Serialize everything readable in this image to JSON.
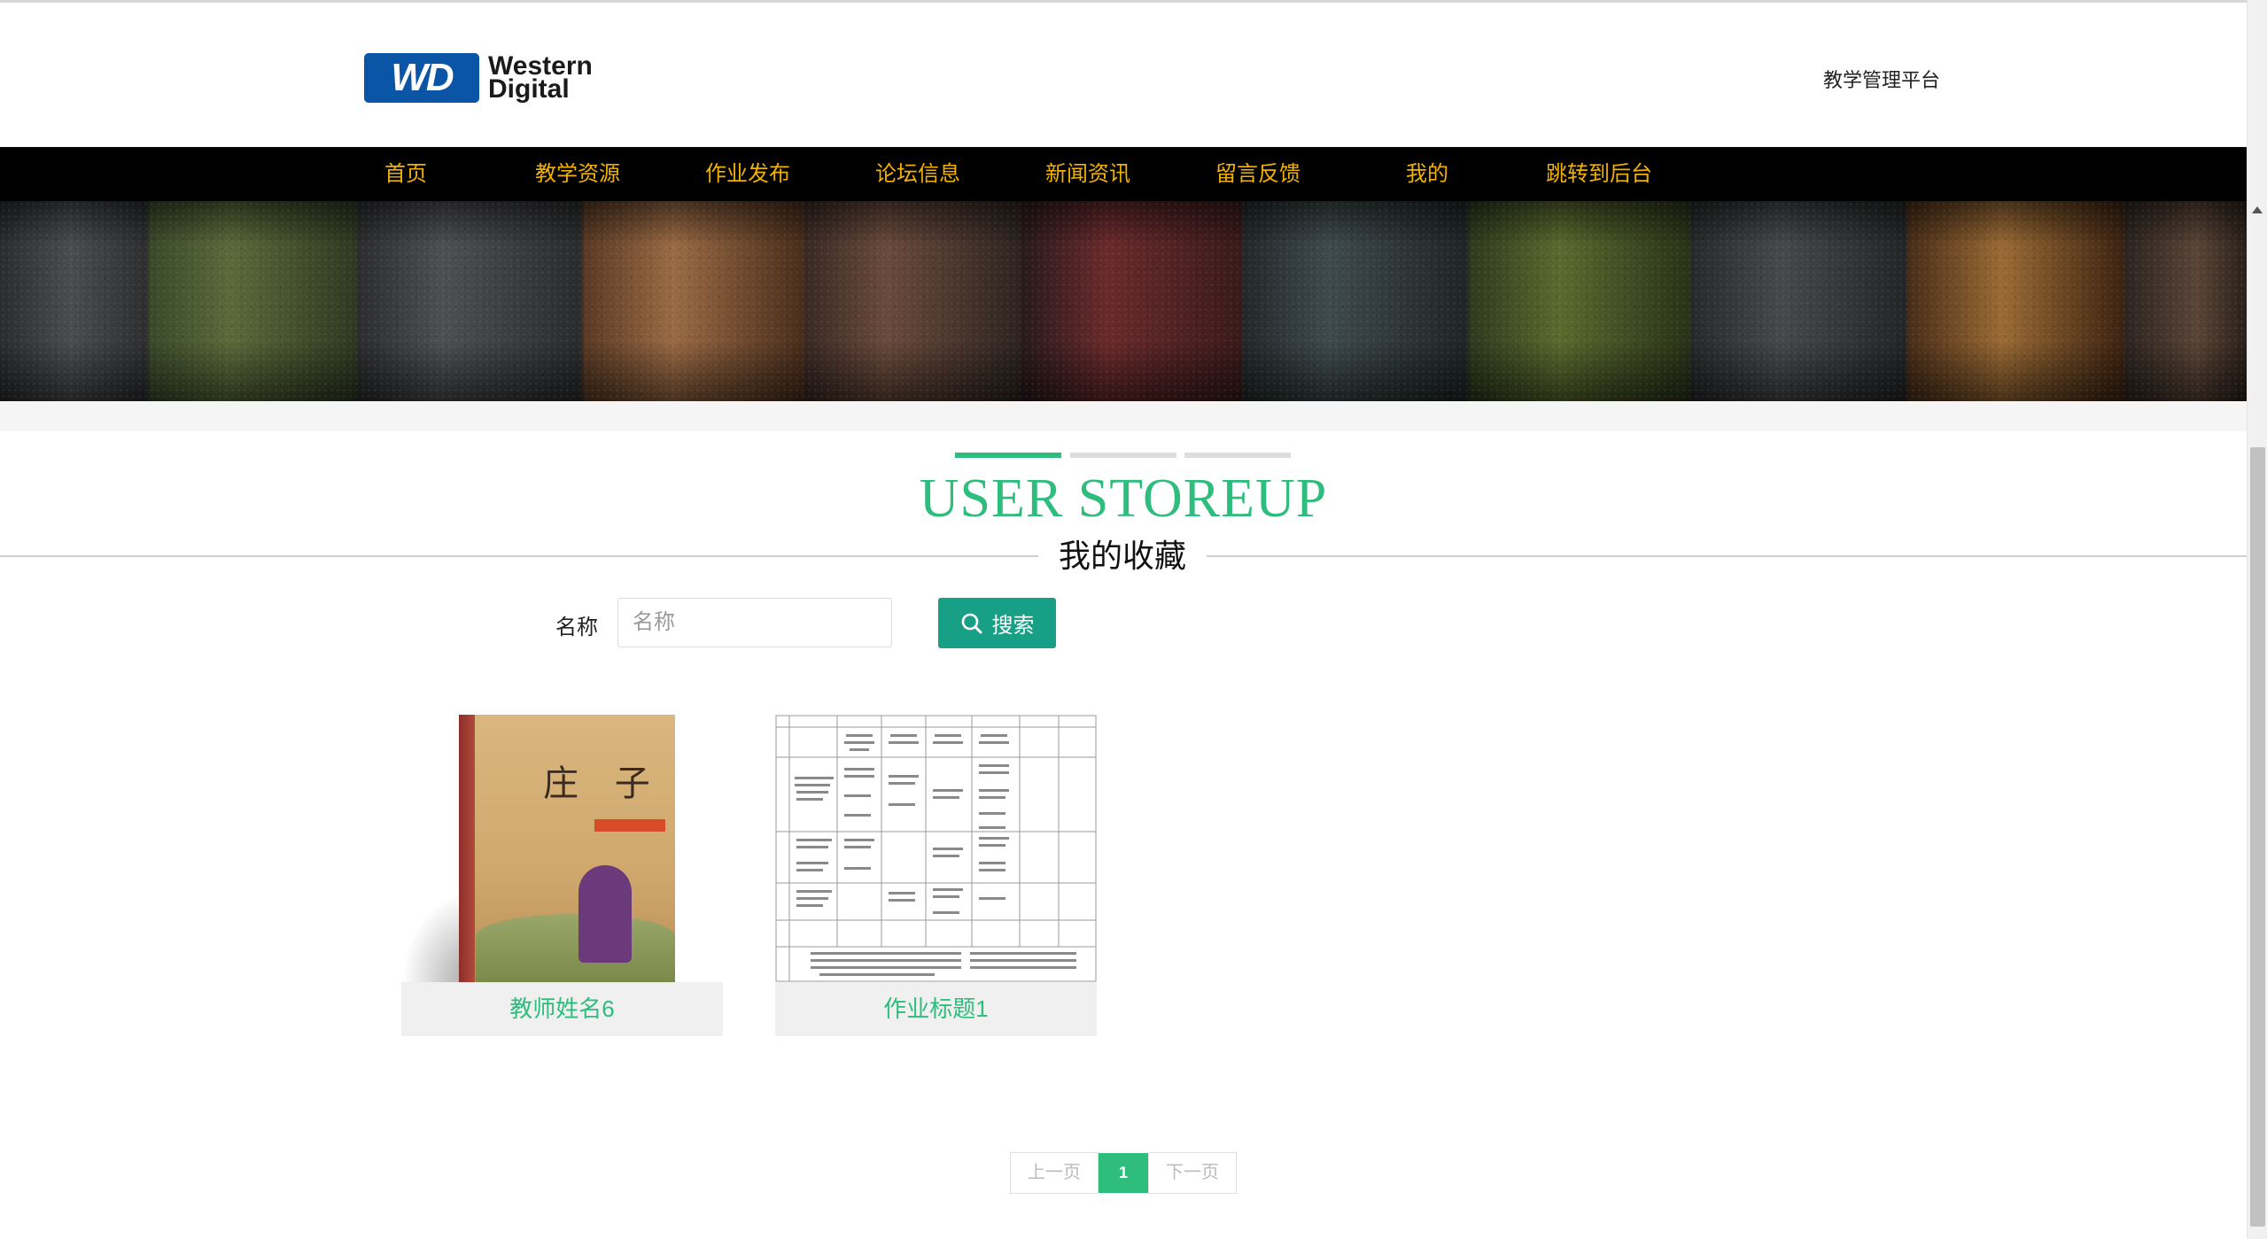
{
  "header": {
    "logo": {
      "badge": "WD",
      "line1": "Western",
      "line2": "Digital"
    },
    "platform_title": "教学管理平台"
  },
  "nav": {
    "items": [
      {
        "label": "首页"
      },
      {
        "label": "教学资源"
      },
      {
        "label": "作业发布"
      },
      {
        "label": "论坛信息"
      },
      {
        "label": "新闻资讯"
      },
      {
        "label": "留言反馈"
      },
      {
        "label": "我的"
      },
      {
        "label": "跳转到后台"
      }
    ],
    "color": "#f2b300"
  },
  "section": {
    "title_en": "USER STOREUP",
    "title_cn": "我的收藏",
    "accent": "#2ebd7d",
    "bars": [
      "#2ebd7d",
      "#dddddd",
      "#dddddd"
    ]
  },
  "search": {
    "label": "名称",
    "placeholder": "名称",
    "value": "",
    "button_label": "搜索",
    "button_icon": "search-icon",
    "button_color": "#17a086"
  },
  "items": [
    {
      "caption": "教师姓名6",
      "cover_text": "庄 子",
      "image": "book-cover"
    },
    {
      "caption": "作业标题1",
      "image": "timetable"
    }
  ],
  "pagination": {
    "prev_label": "上一页",
    "current_page": "1",
    "next_label": "下一页"
  }
}
